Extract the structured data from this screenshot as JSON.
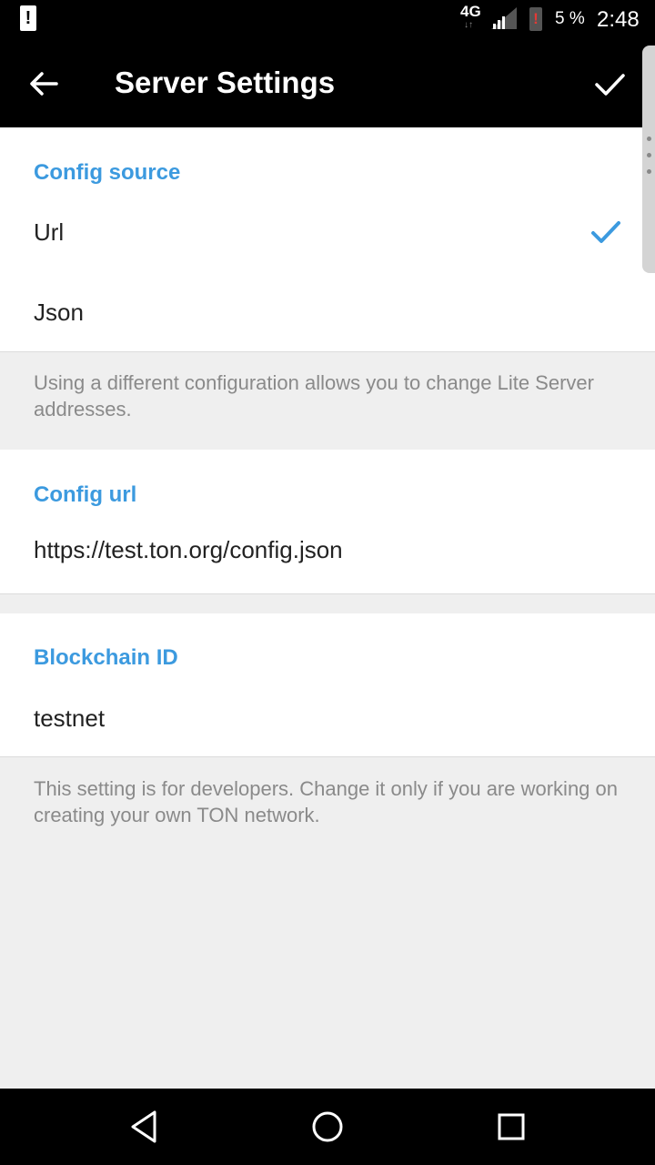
{
  "status_bar": {
    "network_label": "4G",
    "battery_percent": "5 %",
    "time": "2:48",
    "icons": [
      "notification-icon",
      "network-arrows-icon",
      "signal-icon",
      "battery-alert-icon"
    ]
  },
  "toolbar": {
    "title": "Server Settings",
    "back_icon": "arrow-left-icon",
    "done_icon": "checkmark-icon"
  },
  "config_source": {
    "header": "Config source",
    "options": [
      {
        "label": "Url",
        "selected": true
      },
      {
        "label": "Json",
        "selected": false
      }
    ],
    "hint": "Using a different configuration allows you to change Lite Server addresses."
  },
  "config_url": {
    "header": "Config url",
    "value": "https://test.ton.org/config.json"
  },
  "blockchain_id": {
    "header": "Blockchain ID",
    "value": "testnet",
    "hint": "This setting is for developers. Change it only if you are working on creating your own TON network."
  },
  "navigation_bar": {
    "icons": [
      "back-triangle-icon",
      "home-circle-icon",
      "recents-square-icon"
    ]
  },
  "colors": {
    "accent": "#3c9adf",
    "toolbar": "#000000",
    "background": "#efefef"
  }
}
